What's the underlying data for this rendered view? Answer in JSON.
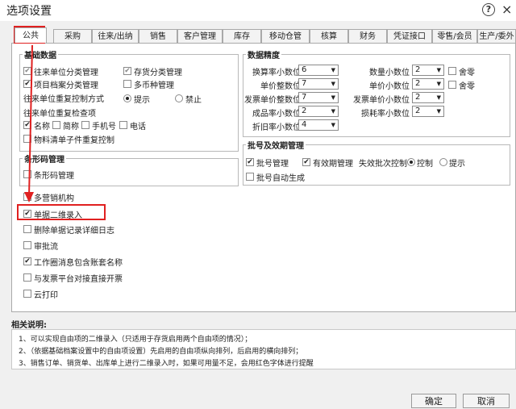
{
  "window": {
    "title": "选项设置",
    "help_icon": "?",
    "close_icon": "×"
  },
  "tabs": [
    "公共",
    "采购",
    "往来/出纳",
    "销售",
    "客户管理",
    "库存",
    "移动仓管",
    "核算",
    "财务",
    "凭证接口",
    "零售/会员",
    "生产/委外"
  ],
  "basic_data": {
    "legend": "基础数据",
    "items": [
      {
        "label": "往来单位分类管理",
        "checked": true,
        "disabled": true
      },
      {
        "label": "存货分类管理",
        "checked": true,
        "disabled": true
      },
      {
        "label": "项目档案分类管理",
        "checked": true,
        "disabled": false
      },
      {
        "label": "多币种管理",
        "checked": false,
        "disabled": false
      }
    ],
    "repeat_control_label": "往来单位重复控制方式",
    "radio_hint": "提示",
    "radio_forbid": "禁止",
    "repeat_check_label": "往来单位重复检查项",
    "check_items": [
      {
        "label": "名称",
        "checked": true
      },
      {
        "label": "简称",
        "checked": false
      },
      {
        "label": "手机号",
        "checked": false
      },
      {
        "label": "电话",
        "checked": false
      }
    ],
    "material_control": "物料清单子件重复控制"
  },
  "barcode": {
    "legend": "条形码管理",
    "item": "条形码管理"
  },
  "options": [
    {
      "label": "多营销机构",
      "checked": false
    },
    {
      "label": "单据二维录入",
      "checked": true
    },
    {
      "label": "删除单据记录详细日志",
      "checked": false
    },
    {
      "label": "审批流",
      "checked": false
    },
    {
      "label": "工作圈消息包含账套名称",
      "checked": true
    },
    {
      "label": "与发票平台对接直接开票",
      "checked": false
    },
    {
      "label": "云打印",
      "checked": false
    }
  ],
  "precision": {
    "legend": "数据精度",
    "rows_left": [
      {
        "label": "换算率小数位",
        "value": "6"
      },
      {
        "label": "单价整数位",
        "value": "7"
      },
      {
        "label": "发票单价整数位",
        "value": "7"
      },
      {
        "label": "成品率小数位",
        "value": "2"
      },
      {
        "label": "折旧率小数位",
        "value": "4"
      }
    ],
    "rows_right": [
      {
        "label": "数量小数位",
        "value": "2",
        "round": "舍零"
      },
      {
        "label": "单价小数位",
        "value": "2",
        "round": "舍零"
      },
      {
        "label": "发票单价小数位",
        "value": "2",
        "round": ""
      },
      {
        "label": "损耗率小数位",
        "value": "2",
        "round": ""
      }
    ]
  },
  "batch": {
    "legend": "批号及效期管理",
    "batch_mgmt": "批号管理",
    "expiry_mgmt": "有效期管理",
    "expired_ctrl": "失效批次控制",
    "radio_ctrl": "控制",
    "radio_hint": "提示",
    "auto_gen": "批号自动生成"
  },
  "notes": {
    "title": "相关说明:",
    "lines": [
      "1、可以实现自由项的二维录入（只适用于存货启用两个自由项的情况）；",
      "2、（依据基础档案设置中的自由项设置）先启用的自由项纵向排列，后启用的横向排列；",
      "3、销售订单、销货单、出库单上进行二维录入时，如果可用量不足，会用红色字体进行提醒"
    ]
  },
  "buttons": {
    "ok": "确定",
    "cancel": "取消"
  },
  "colors": {
    "highlight": "#e02020"
  }
}
